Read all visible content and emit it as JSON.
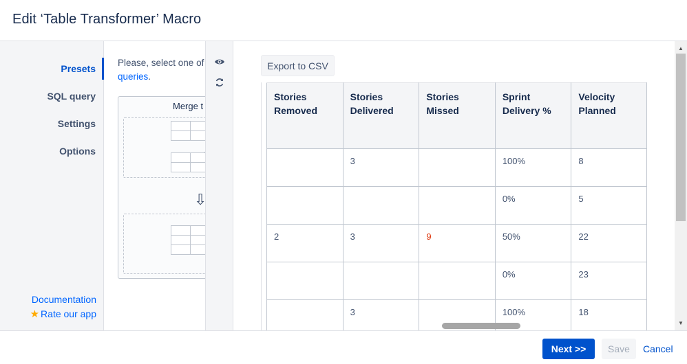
{
  "dialog": {
    "title": "Edit ‘Table Transformer’ Macro"
  },
  "sidebar": {
    "items": [
      {
        "label": "Presets",
        "active": true
      },
      {
        "label": "SQL query",
        "active": false
      },
      {
        "label": "Settings",
        "active": false
      },
      {
        "label": "Options",
        "active": false
      }
    ],
    "documentation_label": "Documentation",
    "rate_label": "Rate our app"
  },
  "presets": {
    "intro_text": "Please, select one of",
    "intro_link": "queries",
    "intro_period": ".",
    "card_title": "Merge t",
    "plus_symbol": "+"
  },
  "toolstrip": {
    "preview_icon": "eye-icon",
    "refresh_icon": "refresh-icon"
  },
  "preview": {
    "export_label": "Export to CSV",
    "columns": [
      "Stories Removed",
      "Stories Delivered",
      "Stories Missed",
      "Sprint Delivery %",
      "Velocity Planned"
    ],
    "rows": [
      [
        "",
        "3",
        "",
        "100%",
        "8"
      ],
      [
        "",
        "",
        "",
        "0%",
        "5"
      ],
      [
        "2",
        "3",
        "9",
        "50%",
        "22"
      ],
      [
        "",
        "",
        "",
        "0%",
        "23"
      ],
      [
        "",
        "3",
        "",
        "100%",
        "18"
      ]
    ],
    "highlight_color": "#de350b"
  },
  "footer": {
    "next_label": "Next >>",
    "save_label": "Save",
    "cancel_label": "Cancel"
  },
  "colors": {
    "primary": "#0052cc",
    "link": "#0065ff",
    "sidebar_bg": "#f4f5f7"
  }
}
